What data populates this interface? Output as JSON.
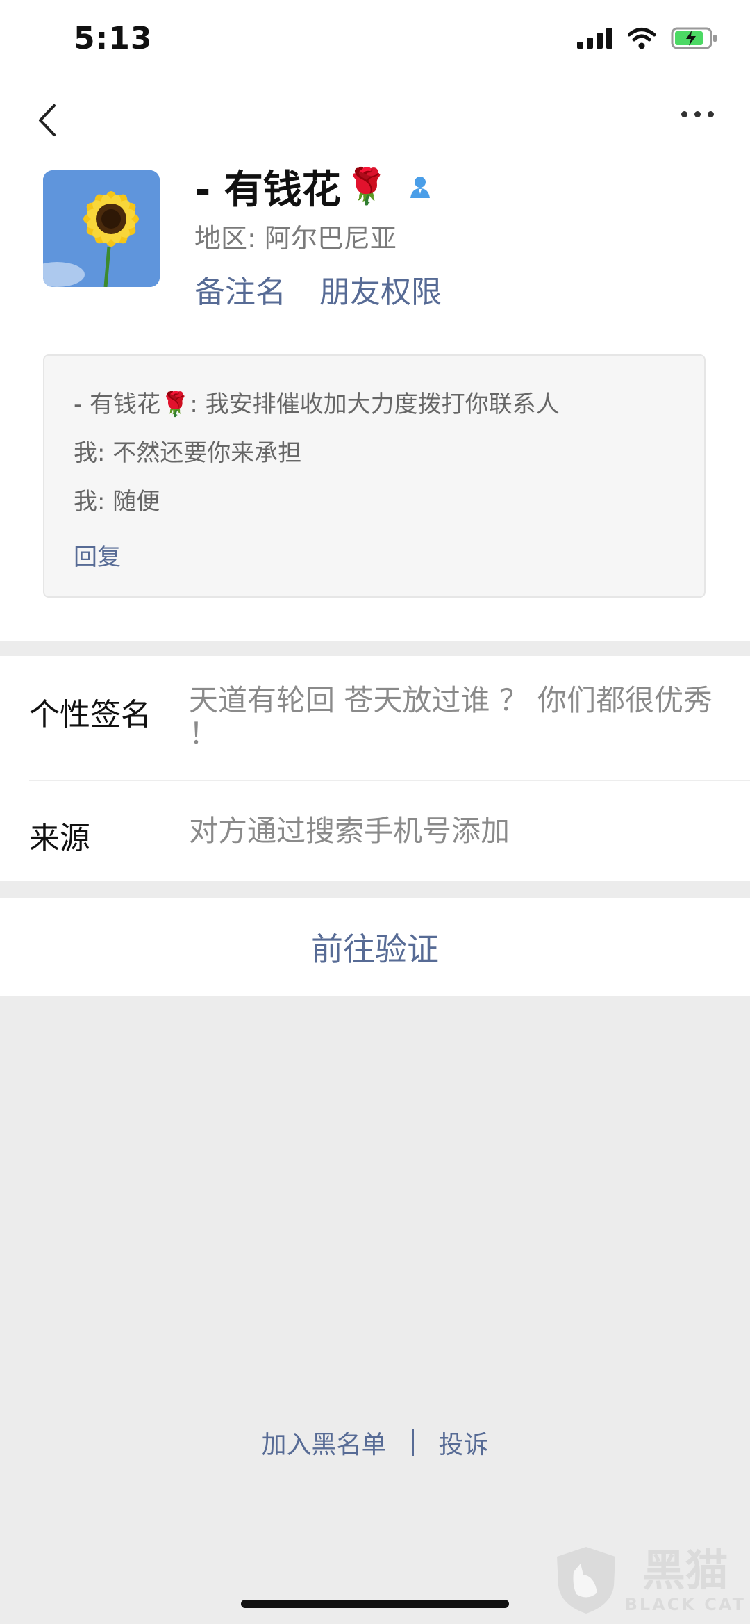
{
  "status": {
    "time": "5:13"
  },
  "profile": {
    "name": "- 有钱花",
    "name_emoji": "🌹",
    "region": "地区: 阿尔巴尼亚",
    "remark_link": "备注名",
    "permission_link": "朋友权限"
  },
  "messages": {
    "line1": "- 有钱花🌹: 我安排催收加大力度拨打你联系人",
    "line2": "我: 不然还要你来承担",
    "line3": "我: 随便",
    "reply": "回复"
  },
  "info": {
    "signature_label": "个性签名",
    "signature_value": "天道有轮回  苍天放过谁  ？  你们都很优秀  ！",
    "source_label": "来源",
    "source_value": "对方通过搜索手机号添加"
  },
  "verify_button": "前往验证",
  "footer": {
    "blacklist": "加入黑名单",
    "complain": "投诉"
  },
  "watermark": {
    "cn": "黑猫",
    "en": "BLACK CAT"
  },
  "colors": {
    "link": "#576b95",
    "background": "#ececec",
    "battery": "#4cd964"
  }
}
